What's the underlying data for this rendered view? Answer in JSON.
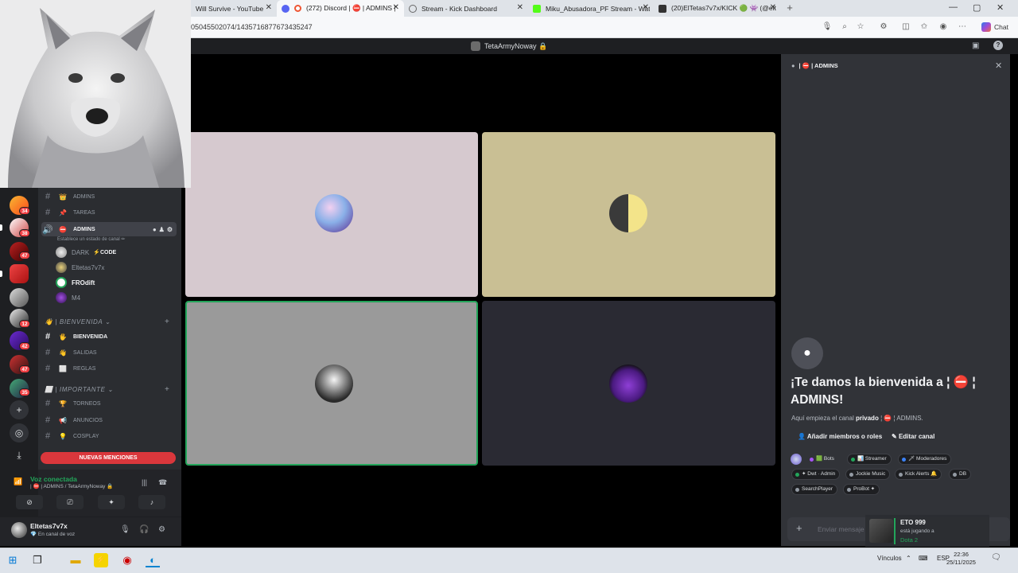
{
  "browser": {
    "tabs": [
      {
        "label": "Will Survive - YouTube"
      },
      {
        "label": "(272) Discord | ⛔ | ADMINS |"
      },
      {
        "label": "Stream - Kick Dashboard"
      },
      {
        "label": "Miku_Abusadora_PF Stream - Wat"
      },
      {
        "label": "(20)ElTetas7v7x/KICK 🟢 👾 (@elt"
      }
    ],
    "url": "05045502074/1435716877673435247",
    "chat_label": "Chat"
  },
  "discord": {
    "title": "TetaArmyNoway 🔒",
    "server_badges": [
      "34",
      "38",
      "47",
      "12",
      "42",
      "47",
      "35"
    ],
    "channels": {
      "top": [
        {
          "emoji": "👑",
          "name": "ADMINS"
        },
        {
          "emoji": "📌",
          "name": "TAREAS"
        }
      ],
      "active_voice": {
        "name": "ADMINS",
        "status": "Establece un estado de canal ✏"
      },
      "voice_users": [
        {
          "name": "DARK",
          "tag": "⚡CODE"
        },
        {
          "name": "Eltetas7v7x"
        },
        {
          "name": "FROdift"
        },
        {
          "name": "M4"
        }
      ],
      "cat1": "👋 | BIENVENIDA ⌄",
      "cat1_items": [
        {
          "emoji": "🖐",
          "name": "BIENVENIDA"
        },
        {
          "emoji": "👋",
          "name": "SALIDAS"
        },
        {
          "emoji": "⬜",
          "name": "REGLAS"
        }
      ],
      "cat2": "⬜ | IMPORTANTE ⌄",
      "cat2_items": [
        {
          "emoji": "🏆",
          "name": "TORNEOS"
        },
        {
          "emoji": "📢",
          "name": "ANUNCIOS"
        },
        {
          "emoji": "💡",
          "name": "COSPLAY"
        }
      ],
      "mentions": "NUEVAS MENCIONES"
    },
    "voice": {
      "title": "Voz conectada",
      "sub": "| ⛔ | ADMINS / TetaArmyNoway 🔒"
    },
    "user": {
      "name": "Eltetas7v7x",
      "status": "💎 En canal de voz"
    },
    "chat": {
      "channel": "| ⛔ | ADMINS",
      "welcome_title": "¡Te damos la bienvenida a ¦ ⛔ ¦ ADMINS!",
      "welcome_pre": "Aquí empieza el canal ",
      "welcome_bold": "privado",
      "welcome_post": " ¦ ⛔ ¦ ADMINS.",
      "add_members": "Añadir miembros o roles",
      "edit_channel": "Editar canal",
      "roles": [
        {
          "label": "🟩 Bots",
          "color": "#a855f7"
        },
        {
          "label": "📊 Streamer",
          "color": "#23a55a"
        },
        {
          "label": "🗡 Moderadores",
          "color": "#3b82f6"
        },
        {
          "label": "✦ Dwt · Admin",
          "color": "#23a55a"
        },
        {
          "label": "Jockie Music",
          "color": "#949ba4"
        },
        {
          "label": "Kick Alerts 🔔",
          "color": "#949ba4"
        },
        {
          "label": "DB",
          "color": "#949ba4"
        },
        {
          "label": "SearchPlayer",
          "color": "#949ba4"
        },
        {
          "label": "ProBot ✦",
          "color": "#949ba4"
        }
      ],
      "placeholder": "Enviar mensaje"
    },
    "activity": {
      "name": "ETO 999",
      "doing": "está jugando a",
      "game": "Dota 2"
    }
  },
  "taskbar": {
    "links": "Vínculos",
    "lang": "ESP",
    "time": "22:36",
    "date": "25/11/2025"
  },
  "colors": {
    "tile1": "#d6c9cf",
    "tile2": "#c9bf94",
    "tile3": "#9a9a9a",
    "tile4": "#2a2a33",
    "speaking": "#23a55a"
  }
}
